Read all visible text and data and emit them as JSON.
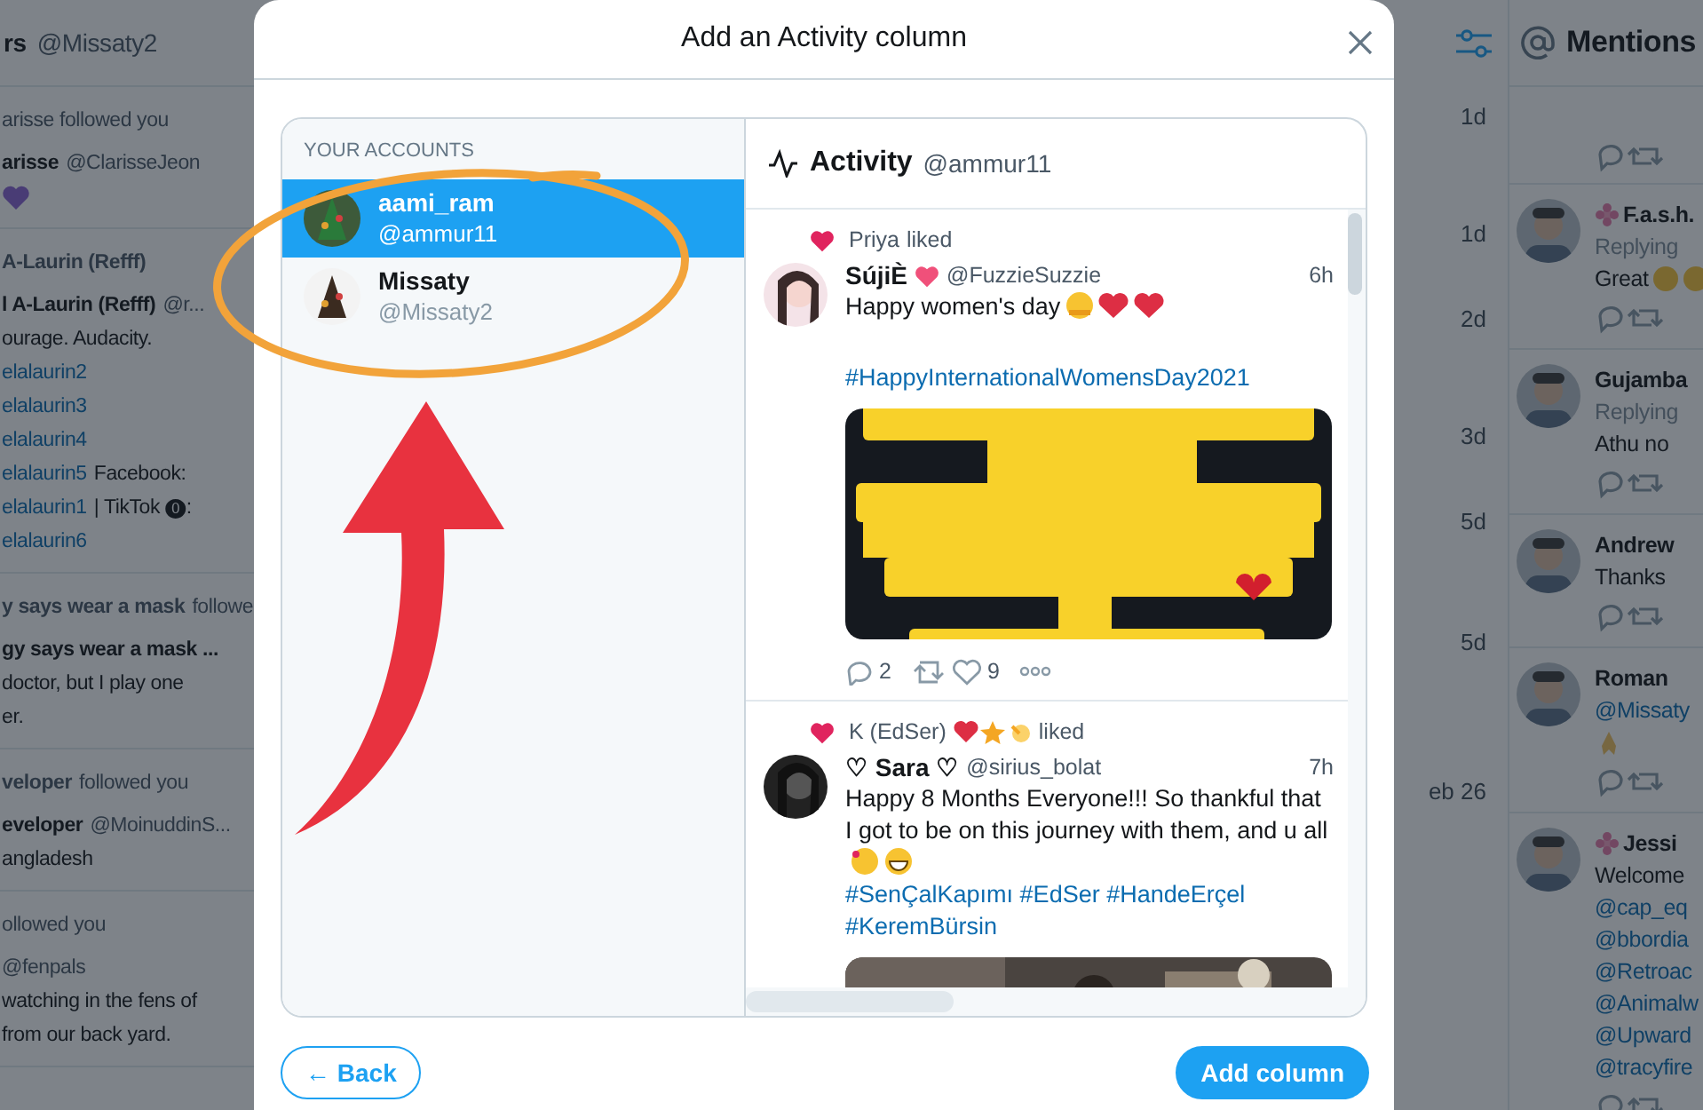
{
  "background": {
    "followers_column": {
      "title": "rs",
      "handle": "@Missaty2",
      "entries": [
        {
          "notice": "arisse followed you",
          "name": "arisse",
          "handle": "@ClarisseJeon",
          "lines": [
            {
              "kind": "heart"
            }
          ]
        },
        {
          "actor": "A-Laurin (Refff)",
          "name": "l A-Laurin (Refff)",
          "handle": "@r...",
          "lines": [
            {
              "kind": "text",
              "text": "ourage. Audacity."
            },
            {
              "kind": "link",
              "text": "elalaurin2"
            },
            {
              "kind": "link",
              "text": "elalaurin3"
            },
            {
              "kind": "link",
              "text": "elalaurin4"
            },
            {
              "kind": "link",
              "text": "elalaurin5",
              "after": "Facebook:"
            },
            {
              "kind": "link",
              "text": "elalaurin1",
              "after": "| TikTok ⓿:"
            },
            {
              "kind": "link",
              "text": "elalaurin6"
            }
          ]
        },
        {
          "actor": "y says wear a mask",
          "notice": "followe",
          "name": "gy says wear a mask ...",
          "lines": [
            {
              "kind": "text",
              "text": "doctor, but I play one"
            },
            {
              "kind": "text",
              "text": "er."
            }
          ]
        },
        {
          "actor": "veloper",
          "notice": "followed you",
          "name": "eveloper",
          "handle": "@MoinuddinS...",
          "lines": [
            {
              "kind": "text",
              "text": "angladesh"
            }
          ]
        },
        {
          "notice": "ollowed you",
          "handle": "@fenpals",
          "lines": [
            {
              "kind": "text",
              "text": "watching in the fens of"
            },
            {
              "kind": "text",
              "text": "from our back yard."
            }
          ]
        }
      ]
    },
    "middle_column": {
      "times": [
        "1d",
        "1d",
        "2d",
        "3d",
        "5d",
        "5d",
        "eb 26"
      ]
    },
    "mentions_column": {
      "title": "Mentions",
      "entries": [
        {
          "kind": "partial"
        },
        {
          "kind": "decorated",
          "name": "F.a.s.h.",
          "lines": [
            {
              "kind": "gray",
              "text": "Replying"
            },
            {
              "kind": "emoji",
              "text": "Great"
            }
          ]
        },
        {
          "kind": "plain",
          "name": "Gujamba",
          "lines": [
            {
              "kind": "gray",
              "text": "Replying"
            },
            {
              "kind": "text",
              "text": "Athu no"
            }
          ]
        },
        {
          "kind": "plain",
          "name": "Andrew",
          "lines": [
            {
              "kind": "text",
              "text": "Thanks"
            }
          ]
        },
        {
          "kind": "plain",
          "name": "Roman",
          "lines": [
            {
              "kind": "link",
              "text": "@Missaty"
            },
            {
              "kind": "pray"
            }
          ]
        },
        {
          "kind": "decorated",
          "name": "Jessi",
          "lines": [
            {
              "kind": "text",
              "text": "Welcome"
            },
            {
              "kind": "link",
              "text": "@cap_eq"
            },
            {
              "kind": "link",
              "text": "@bbordia"
            },
            {
              "kind": "link",
              "text": "@Retroac"
            },
            {
              "kind": "link",
              "text": "@Animalw"
            },
            {
              "kind": "link",
              "text": "@Upward"
            },
            {
              "kind": "link",
              "text": "@tracyfire"
            }
          ]
        }
      ]
    }
  },
  "modal": {
    "title": "Add an Activity column",
    "accounts_label": "YOUR ACCOUNTS",
    "accounts": [
      {
        "name": "aami_ram",
        "handle": "@ammur11",
        "selected": true
      },
      {
        "name": "Missaty",
        "handle": "@Missaty2",
        "selected": false
      }
    ],
    "activity": {
      "title": "Activity",
      "handle": "@ammur11",
      "tweets": [
        {
          "liker": "Priya",
          "liked": "liked",
          "name": "SújiÈ",
          "name_heart": true,
          "handle": "@FuzzieSuzzie",
          "time": "6h",
          "lines": [
            {
              "kind": "hugtext",
              "text": "Happy women's day"
            },
            {
              "kind": "gap"
            },
            {
              "kind": "link",
              "text": "#HappyInternationalWomensDay2021"
            }
          ],
          "replies": "2",
          "likes": "9"
        },
        {
          "liker": "K (EdSer)",
          "liker_emojis": true,
          "liked": "liked",
          "name": "♡ Sara ♡",
          "handle": "@sirius_bolat",
          "time": "7h",
          "lines": [
            {
              "kind": "smiletext",
              "text": "Happy 8 Months Everyone!!! So thankful that I got to be on this journey with them, and u all"
            },
            {
              "kind": "link",
              "text": "#SenÇalKapımı #EdSer #HandeErçel"
            },
            {
              "kind": "link",
              "text": "#KeremBürsin"
            }
          ]
        }
      ]
    },
    "back_button": "← Back",
    "add_button": "Add column"
  }
}
